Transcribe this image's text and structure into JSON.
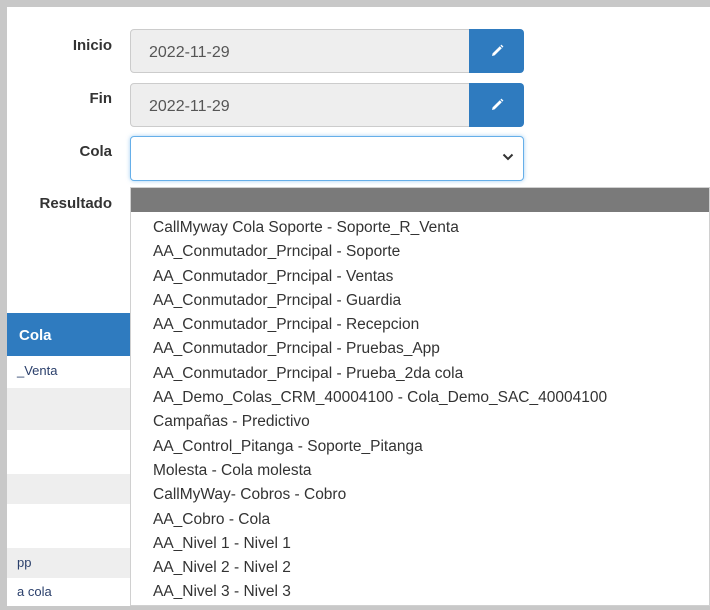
{
  "form": {
    "inicio_label": "Inicio",
    "inicio_value": "2022-11-29",
    "fin_label": "Fin",
    "fin_value": "2022-11-29",
    "cola_label": "Cola",
    "cola_value": "",
    "resultado_label": "Resultado"
  },
  "icons": {
    "edit": "pencil-icon",
    "select": "chevron-down-icon"
  },
  "colors": {
    "accent": "#2f7bbf",
    "input_bg": "#eeeeee",
    "dropdown_header": "#7a7a7a"
  },
  "table": {
    "header": "Cola",
    "rows": [
      "_Venta",
      "",
      "",
      "",
      "",
      "pp",
      "a cola"
    ]
  },
  "dropdown": {
    "options": [
      "CallMyway Cola Soporte - Soporte_R_Venta",
      "AA_Conmutador_Prncipal - Soporte",
      "AA_Conmutador_Prncipal - Ventas",
      "AA_Conmutador_Prncipal - Guardia",
      "AA_Conmutador_Prncipal - Recepcion",
      "AA_Conmutador_Prncipal - Pruebas_App",
      "AA_Conmutador_Prncipal - Prueba_2da cola",
      "AA_Demo_Colas_CRM_40004100 - Cola_Demo_SAC_40004100",
      "Campañas - Predictivo",
      "AA_Control_Pitanga - Soporte_Pitanga",
      "Molesta - Cola molesta",
      "CallMyWay- Cobros - Cobro",
      "AA_Cobro - Cola",
      "AA_Nivel 1 - Nivel 1",
      "AA_Nivel 2 - Nivel 2",
      "AA_Nivel 3 - Nivel 3"
    ]
  }
}
